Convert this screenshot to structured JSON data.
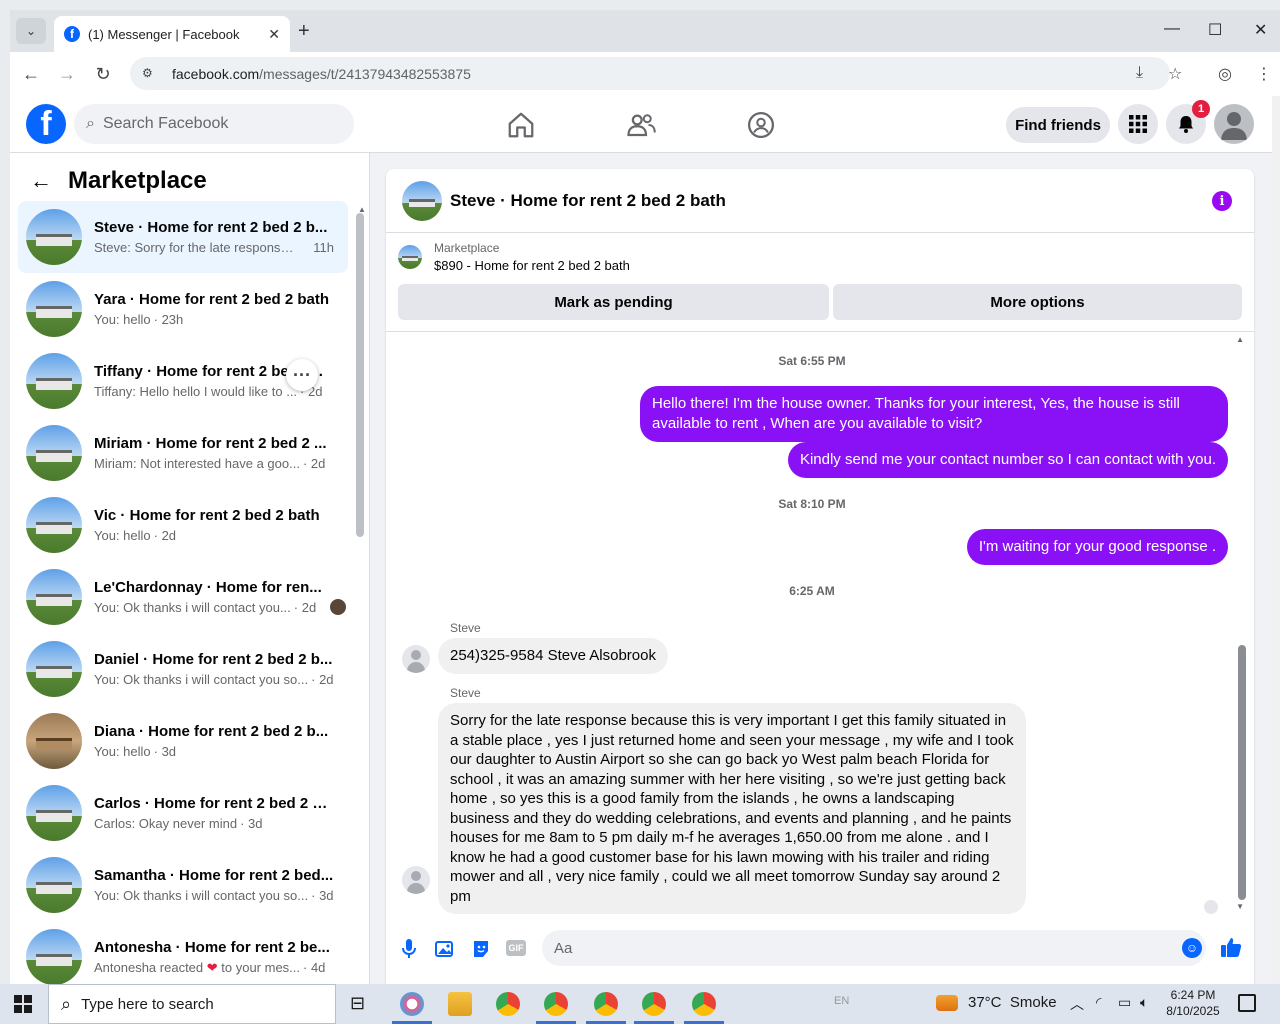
{
  "browser": {
    "tab_title": "(1) Messenger | Facebook",
    "tab_close": "✕",
    "new_tab": "+",
    "url_host": "facebook.com",
    "url_path": "/messages/t/24137943482553875"
  },
  "fb": {
    "search_placeholder": "Search Facebook",
    "find_friends": "Find friends",
    "notification_count": "1"
  },
  "marketplace": {
    "title": "Marketplace",
    "conversations": [
      {
        "name": "Steve · Home for rent 2 bed 2 b...",
        "snippet": "Steve: Sorry for the late response ...",
        "time": "11h",
        "active": true
      },
      {
        "name": "Yara · Home for rent 2 bed 2 bath",
        "snippet": "You: hello",
        "time": "· 23h"
      },
      {
        "name": "Tiffany · Home for rent 2 bed 2...",
        "snippet": "Tiffany: Hello hello I would like to ...",
        "time": "· 2d"
      },
      {
        "name": "Miriam · Home for rent 2 bed 2 ...",
        "snippet": "Miriam: Not interested have a goo...",
        "time": "· 2d"
      },
      {
        "name": "Vic · Home for rent 2 bed 2 bath",
        "snippet": "You: hello",
        "time": "· 2d"
      },
      {
        "name": "Le'Chardonnay · Home for ren...",
        "snippet": "You: Ok thanks i will contact you...",
        "time": "· 2d"
      },
      {
        "name": "Daniel · Home for rent 2 bed 2 b...",
        "snippet": "You: Ok thanks i will contact you so...",
        "time": "· 2d"
      },
      {
        "name": "Diana · Home for rent 2 bed 2 b...",
        "snippet": "You: hello",
        "time": "· 3d"
      },
      {
        "name": "Carlos · Home for rent 2 bed 2 b...",
        "snippet": "Carlos: Okay never mind",
        "time": "· 3d"
      },
      {
        "name": "Samantha · Home for rent 2 bed...",
        "snippet": "You: Ok thanks i will contact you so...",
        "time": "· 3d"
      },
      {
        "name": "Antonesha · Home for rent 2 be...",
        "snippet_pre": "Antonesha reacted",
        "snippet_post": "to your mes...",
        "time": "· 4d"
      }
    ]
  },
  "chat": {
    "title": "Steve · Home for rent 2 bed 2 bath",
    "listing_label": "Marketplace",
    "listing_price": "$890 - Home for rent 2 bed 2 bath",
    "mark_pending": "Mark as pending",
    "more_options": "More options",
    "ts1": "Sat 6:55 PM",
    "out1": "Hello there! I'm the house owner. Thanks for your interest, Yes, the house is still available to rent , When are you available to visit?",
    "out2": "Kindly send me your contact number so I can contact with you.",
    "ts2": "Sat 8:10 PM",
    "out3": "I'm waiting for your  good response .",
    "ts3": "6:25 AM",
    "sender": "Steve",
    "in1": "254)325-9584 Steve Alsobrook",
    "in2": "Sorry for the late response because this is very important I get this family situated in a stable place , yes I just returned home and seen your message , my wife and I took our daughter to Austin Airport so she can go back yo West palm beach Florida for school , it was an amazing summer with her here visiting , so we're just getting back home , so yes this is a good family from the islands , he owns a landscaping business and they do wedding celebrations, and events and planning , and he paints houses for me 8am to 5 pm daily m-f  he averages 1,650.00 from me alone . and I know he had a good customer base for his lawn mowing with his trailer and riding mower and all , very nice family , could we all meet tomorrow Sunday say around 2 pm",
    "composer_placeholder": "Aa",
    "gif_label": "GIF"
  },
  "taskbar": {
    "search_placeholder": "Type here to search",
    "language": "EN",
    "temperature": "37°C",
    "weather": "Smoke",
    "time": "6:24 PM",
    "date": "8/10/2025"
  },
  "colors": {
    "fb_blue": "#0866ff",
    "outgoing_bubble": "#8a10f5",
    "badge_red": "#e41e3f"
  }
}
